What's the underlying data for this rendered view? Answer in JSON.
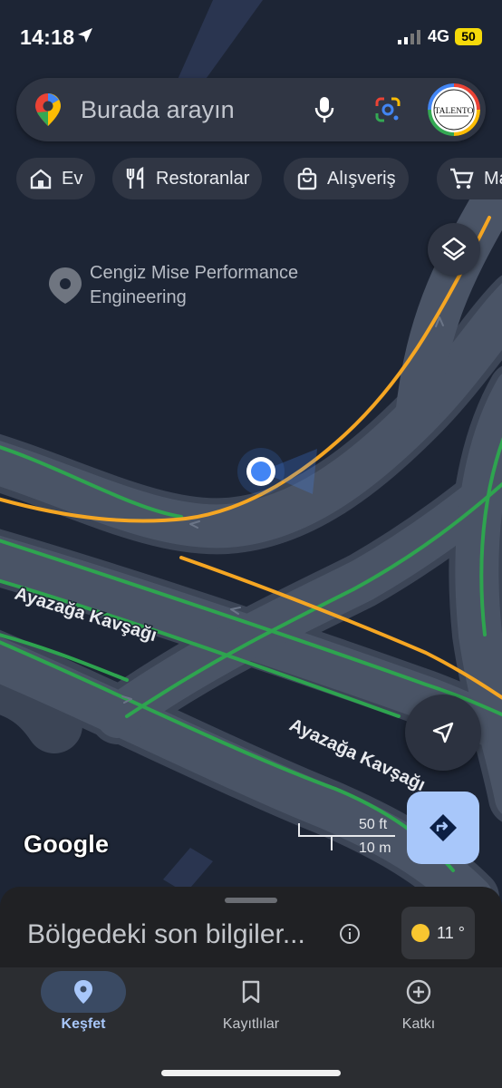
{
  "status_bar": {
    "time": "14:18",
    "network": "4G",
    "battery": "50"
  },
  "search": {
    "placeholder": "Burada arayın",
    "avatar_text": "TALENTO"
  },
  "chips": [
    {
      "label": "Ev",
      "icon": "home-icon"
    },
    {
      "label": "Restoranlar",
      "icon": "restaurant-icon"
    },
    {
      "label": "Alışveriş",
      "icon": "shopping-bag-icon"
    },
    {
      "label": "Market",
      "icon": "cart-icon"
    }
  ],
  "map": {
    "poi_name": "Cengiz Mise Performance Engineering",
    "road_name_1": "Ayazağa Kavşağı",
    "road_name_2": "Ayazağa Kavşağı",
    "attribution": "Google",
    "scale_ft": "50 ft",
    "scale_m": "10 m"
  },
  "sheet": {
    "title": "Bölgedeki son bilgiler...",
    "weather_temp": "11 °"
  },
  "bottom_nav": [
    {
      "label": "Keşfet",
      "icon": "explore-pin-icon",
      "active": true
    },
    {
      "label": "Kayıtlılar",
      "icon": "bookmark-icon",
      "active": false
    },
    {
      "label": "Katkı",
      "icon": "add-circle-icon",
      "active": false
    }
  ],
  "colors": {
    "accent": "#a8c7fa",
    "map_bg": "#1d2535",
    "road": "#4b5566",
    "traffic_green": "#2ea44f",
    "traffic_orange": "#f5a623",
    "location_dot": "#4285f4"
  }
}
